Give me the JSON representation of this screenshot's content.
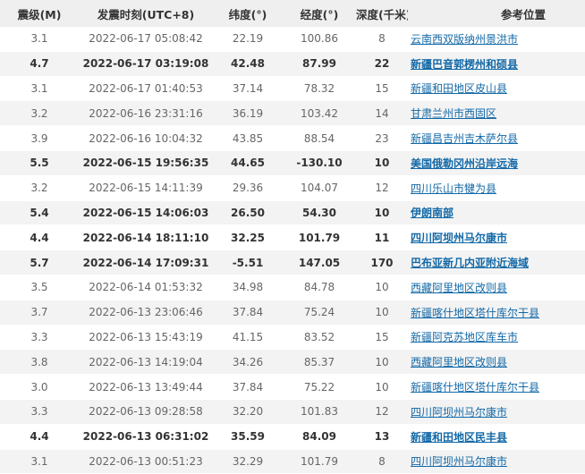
{
  "headers": {
    "mag": "震级(M)",
    "time": "发震时刻(UTC+8)",
    "lat": "纬度(°)",
    "lon": "经度(°)",
    "depth": "深度(千米)",
    "location": "参考位置"
  },
  "rows": [
    {
      "mag": "3.1",
      "time": "2022-06-17 05:08:42",
      "lat": "22.19",
      "lon": "100.86",
      "depth": "8",
      "location": "云南西双版纳州景洪市",
      "bold": false
    },
    {
      "mag": "4.7",
      "time": "2022-06-17 03:19:08",
      "lat": "42.48",
      "lon": "87.99",
      "depth": "22",
      "location": "新疆巴音郭楞州和硕县",
      "bold": true
    },
    {
      "mag": "3.1",
      "time": "2022-06-17 01:40:53",
      "lat": "37.14",
      "lon": "78.32",
      "depth": "15",
      "location": "新疆和田地区皮山县",
      "bold": false
    },
    {
      "mag": "3.2",
      "time": "2022-06-16 23:31:16",
      "lat": "36.19",
      "lon": "103.42",
      "depth": "14",
      "location": "甘肃兰州市西固区",
      "bold": false
    },
    {
      "mag": "3.9",
      "time": "2022-06-16 10:04:32",
      "lat": "43.85",
      "lon": "88.54",
      "depth": "23",
      "location": "新疆昌吉州吉木萨尔县",
      "bold": false
    },
    {
      "mag": "5.5",
      "time": "2022-06-15 19:56:35",
      "lat": "44.65",
      "lon": "-130.10",
      "depth": "10",
      "location": "美国俄勒冈州沿岸远海",
      "bold": true
    },
    {
      "mag": "3.2",
      "time": "2022-06-15 14:11:39",
      "lat": "29.36",
      "lon": "104.07",
      "depth": "12",
      "location": "四川乐山市犍为县",
      "bold": false
    },
    {
      "mag": "5.4",
      "time": "2022-06-15 14:06:03",
      "lat": "26.50",
      "lon": "54.30",
      "depth": "10",
      "location": "伊朗南部",
      "bold": true
    },
    {
      "mag": "4.4",
      "time": "2022-06-14 18:11:10",
      "lat": "32.25",
      "lon": "101.79",
      "depth": "11",
      "location": "四川阿坝州马尔康市",
      "bold": true
    },
    {
      "mag": "5.7",
      "time": "2022-06-14 17:09:31",
      "lat": "-5.51",
      "lon": "147.05",
      "depth": "170",
      "location": "巴布亚新几内亚附近海域",
      "bold": true
    },
    {
      "mag": "3.5",
      "time": "2022-06-14 01:53:32",
      "lat": "34.98",
      "lon": "84.78",
      "depth": "10",
      "location": "西藏阿里地区改则县",
      "bold": false
    },
    {
      "mag": "3.7",
      "time": "2022-06-13 23:06:46",
      "lat": "37.84",
      "lon": "75.24",
      "depth": "10",
      "location": "新疆喀什地区塔什库尔干县",
      "bold": false
    },
    {
      "mag": "3.3",
      "time": "2022-06-13 15:43:19",
      "lat": "41.15",
      "lon": "83.52",
      "depth": "15",
      "location": "新疆阿克苏地区库车市",
      "bold": false
    },
    {
      "mag": "3.8",
      "time": "2022-06-13 14:19:04",
      "lat": "34.26",
      "lon": "85.37",
      "depth": "10",
      "location": "西藏阿里地区改则县",
      "bold": false
    },
    {
      "mag": "3.0",
      "time": "2022-06-13 13:49:44",
      "lat": "37.84",
      "lon": "75.22",
      "depth": "10",
      "location": "新疆喀什地区塔什库尔干县",
      "bold": false
    },
    {
      "mag": "3.3",
      "time": "2022-06-13 09:28:58",
      "lat": "32.20",
      "lon": "101.83",
      "depth": "12",
      "location": "四川阿坝州马尔康市",
      "bold": false
    },
    {
      "mag": "4.4",
      "time": "2022-06-13 06:31:02",
      "lat": "35.59",
      "lon": "84.09",
      "depth": "13",
      "location": "新疆和田地区民丰县",
      "bold": true
    },
    {
      "mag": "3.1",
      "time": "2022-06-13 00:51:23",
      "lat": "32.29",
      "lon": "101.79",
      "depth": "8",
      "location": "四川阿坝州马尔康市",
      "bold": false
    }
  ]
}
